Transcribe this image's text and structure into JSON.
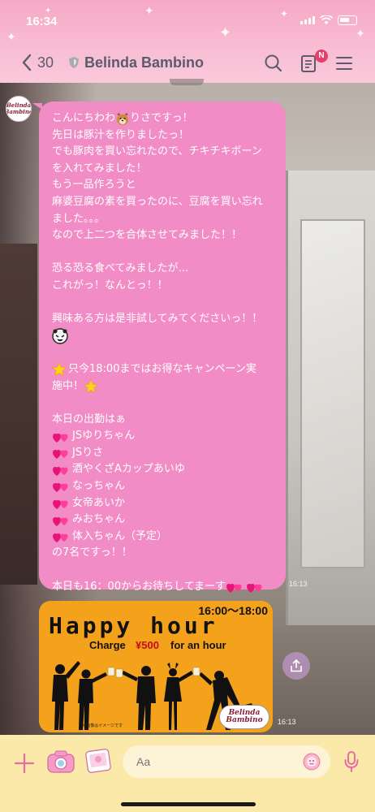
{
  "status_bar": {
    "time": "16:34"
  },
  "header": {
    "back_count": "30",
    "chat_title": "Belinda Bambino",
    "notes_badge": "N"
  },
  "avatar": {
    "logo_line1": "Belinda",
    "logo_line2": "Bambino"
  },
  "message": {
    "lines_top": [
      "こんにちわわ",
      "りさですっ！",
      "先日は豚汁を作りましたっ！",
      "でも豚肉を買い忘れたので、チキチキボーン",
      "を入れてみました！",
      "もう一品作ろうと",
      "麻婆豆腐の素を買ったのに、豆腐を買い忘れ",
      "ました。。。",
      "なので上二つを合体させてみました！！",
      "恐る恐る食べてみましたが…",
      "これがっ！なんとっ！！",
      "興味ある方は是非試してみてくださいっ！！"
    ],
    "campaign_line1": "只今18:00まではお得なキャンペーン実",
    "campaign_line2": "施中！",
    "roster_intro": "本日の出勤はぁ",
    "roster": [
      "JSゆりちゃん",
      "JSりさ",
      "酒やくざAカップあいゆ",
      "なっちゃん",
      "女帝あいか",
      "みおちゃん",
      "体入ちゃん（予定）"
    ],
    "roster_total": "の7名ですっ！！",
    "closing": "本日も16：00からお待ちしてまーす",
    "timestamp": "16:13"
  },
  "image_message": {
    "time_range": "16:00～18:00",
    "title": "Happy hour",
    "charge_label": "Charge",
    "price": "¥500",
    "for_hour": "for an hour",
    "note": "※画像はイメージです",
    "logo_line1": "Belinda",
    "logo_line2": "Bambino",
    "timestamp": "16:13"
  },
  "input_bar": {
    "placeholder": "Aa"
  },
  "colors": {
    "header_pink": "#f8bcd2",
    "bubble_pink": "#f28cc6",
    "input_bar_yellow": "#fae9a8",
    "image_orange": "#f4a21b",
    "price_red": "#c40d1c",
    "nav_text": "#5b5b6d"
  },
  "icons": [
    "back-chevron-icon",
    "shield-icon",
    "search-icon",
    "notes-icon",
    "menu-icon",
    "share-icon",
    "plus-icon",
    "camera-sticker-icon",
    "photo-sticker-icon",
    "emoji-icon",
    "mic-icon",
    "heart-icon",
    "star-icon",
    "dog-face-icon",
    "bear-face-icon"
  ]
}
